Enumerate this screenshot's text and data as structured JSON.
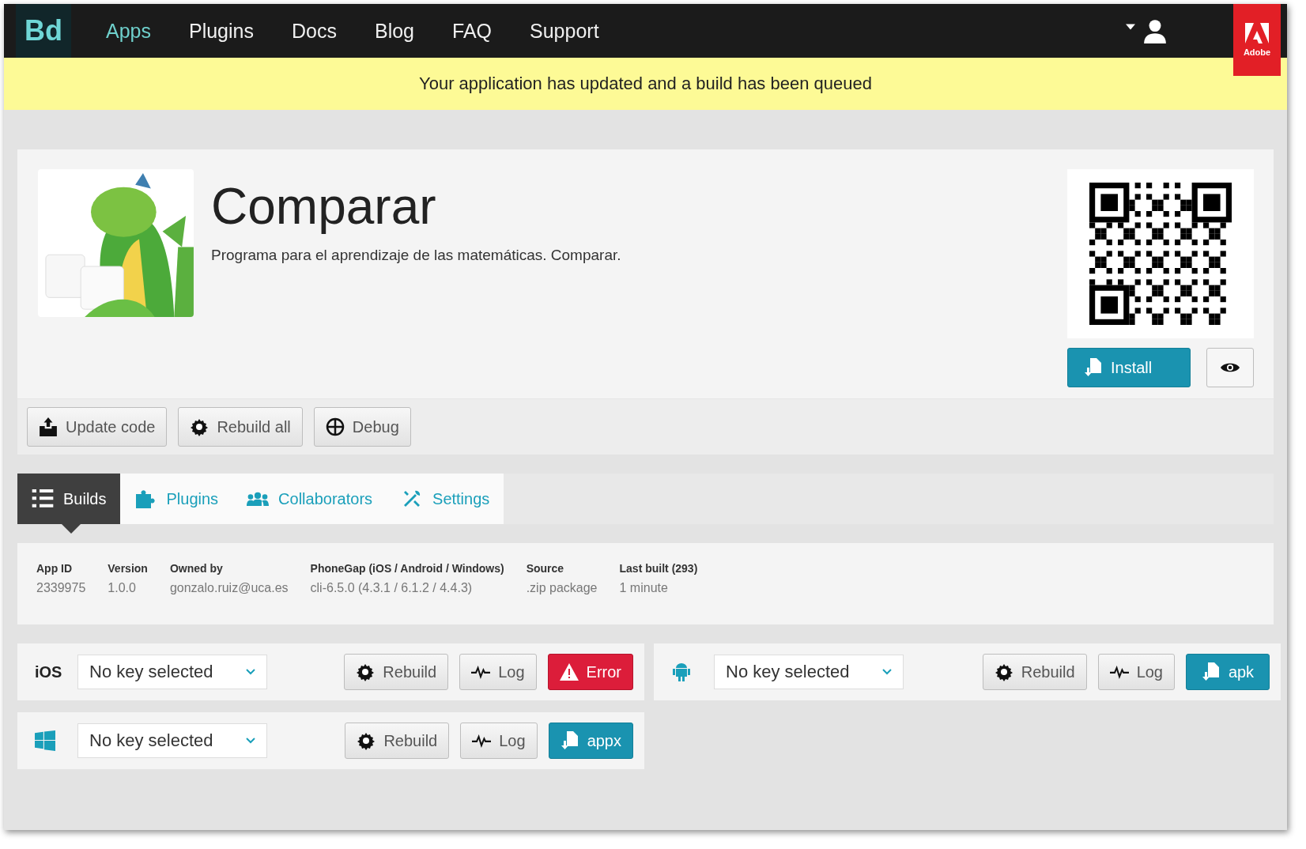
{
  "nav": {
    "logo": "Bd",
    "items": [
      {
        "label": "Apps",
        "selected": true
      },
      {
        "label": "Plugins",
        "selected": false
      },
      {
        "label": "Docs",
        "selected": false
      },
      {
        "label": "Blog",
        "selected": false
      },
      {
        "label": "FAQ",
        "selected": false
      },
      {
        "label": "Support",
        "selected": false
      }
    ],
    "brand": "Adobe"
  },
  "banner": "Your application has updated and a build has been queued",
  "app": {
    "title": "Comparar",
    "description": "Programa para el aprendizaje de las matemáticas. Comparar.",
    "install": "Install"
  },
  "actions": [
    "Update code",
    "Rebuild all",
    "Debug"
  ],
  "tabs": [
    {
      "label": "Builds",
      "selected": true
    },
    {
      "label": "Plugins",
      "selected": false
    },
    {
      "label": "Collaborators",
      "selected": false
    },
    {
      "label": "Settings",
      "selected": false
    }
  ],
  "info": [
    {
      "label": "App ID",
      "value": "2339975"
    },
    {
      "label": "Version",
      "value": "1.0.0"
    },
    {
      "label": "Owned by",
      "value": "gonzalo.ruiz@uca.es"
    },
    {
      "label": "PhoneGap (iOS / Android / Windows)",
      "value": "cli-6.5.0 (4.3.1 / 6.1.2 / 4.4.3)"
    },
    {
      "label": "Source",
      "value": ".zip package"
    },
    {
      "label": "Last built (293)",
      "value": "1 minute"
    }
  ],
  "platforms": [
    {
      "kind": "ios",
      "label": "iOS",
      "key": "No key selected",
      "rebuild": "Rebuild",
      "log": "Log",
      "status": {
        "kind": "error",
        "label": "Error"
      }
    },
    {
      "kind": "android",
      "key": "No key selected",
      "rebuild": "Rebuild",
      "log": "Log",
      "status": {
        "kind": "download",
        "label": "apk"
      }
    },
    {
      "kind": "windows",
      "key": "No key selected",
      "rebuild": "Rebuild",
      "log": "Log",
      "status": {
        "kind": "download",
        "label": "appx"
      }
    }
  ]
}
